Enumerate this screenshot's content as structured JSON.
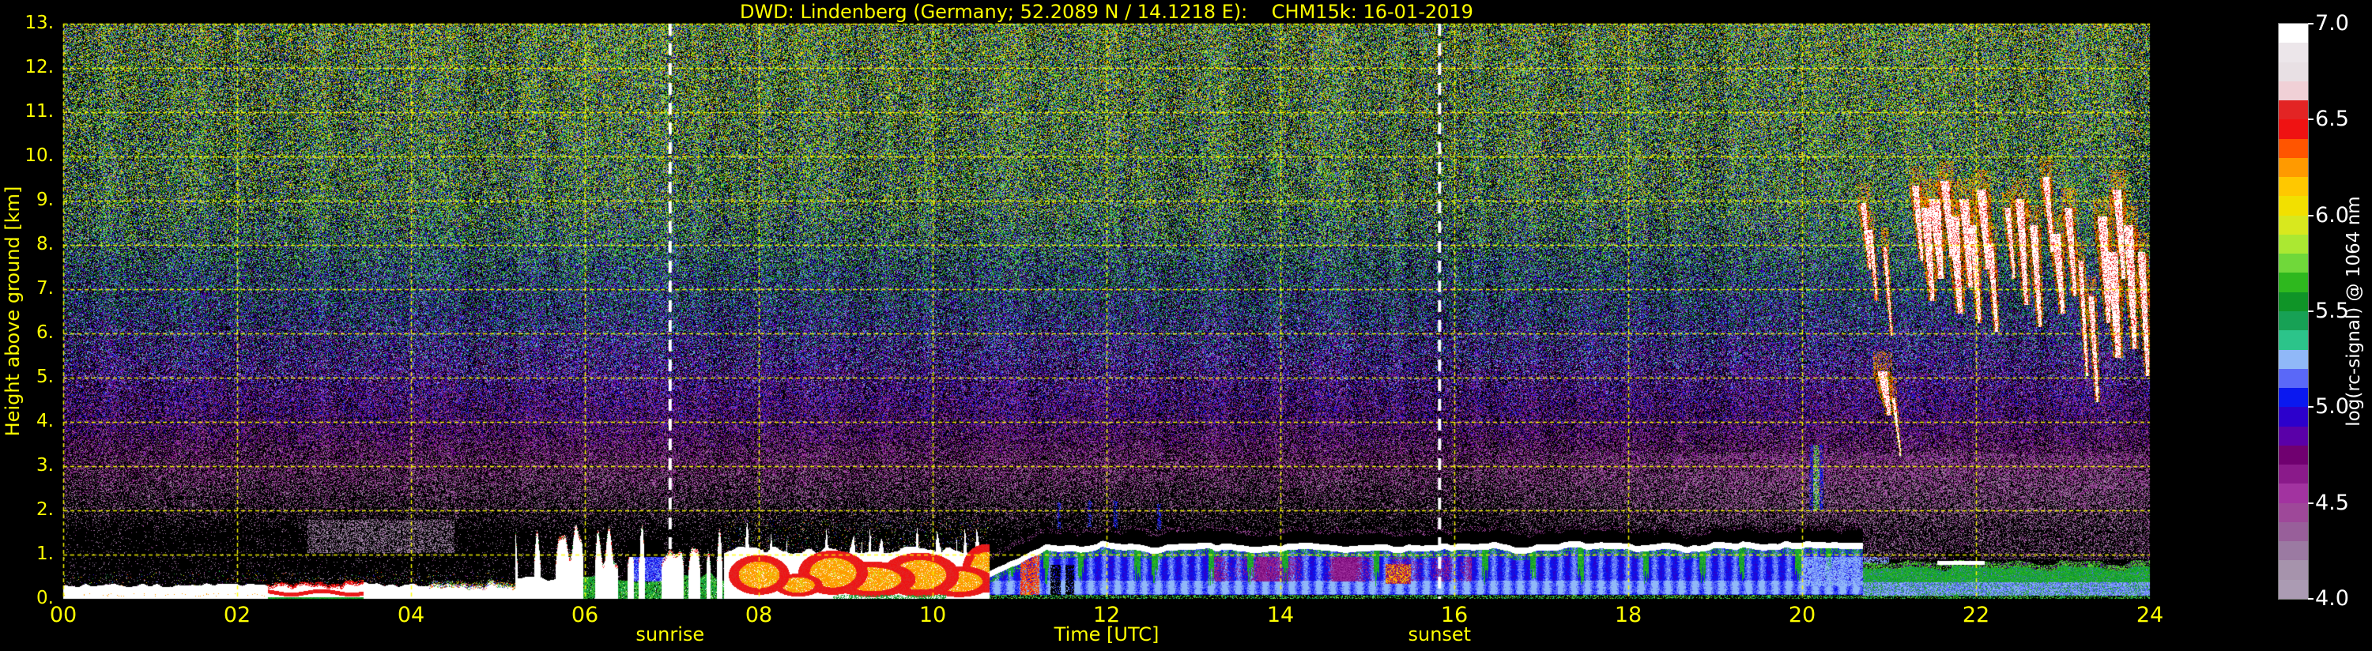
{
  "title": "DWD: Lindenberg (Germany; 52.2089 N / 14.1218 E):    CHM15k: 16-01-2019",
  "colors": {
    "background": "#000000",
    "axis_text": "#ffff00",
    "grid_line": "#ffff00",
    "sun_line": "#ffffff",
    "colorbar_text": "#ffffff",
    "colorbar_border": "#777777"
  },
  "x_axis": {
    "label": "Time [UTC]",
    "tick_labels": [
      "00",
      "02",
      "04",
      "06",
      "08",
      "10",
      "12",
      "14",
      "16",
      "18",
      "20",
      "22",
      "24"
    ],
    "tick_hours": [
      0,
      2,
      4,
      6,
      8,
      10,
      12,
      14,
      16,
      18,
      20,
      22,
      24
    ],
    "range_hours": [
      0,
      24
    ]
  },
  "y_axis": {
    "label": "Height above ground [km]",
    "tick_labels": [
      "0.",
      "1.",
      "2.",
      "3.",
      "4.",
      "5.",
      "6.",
      "7.",
      "8.",
      "9.",
      "10.",
      "11.",
      "12.",
      "13."
    ],
    "tick_km": [
      0,
      1,
      2,
      3,
      4,
      5,
      6,
      7,
      8,
      9,
      10,
      11,
      12,
      13
    ],
    "range_km": [
      0,
      13
    ]
  },
  "annotations": {
    "sunrise": {
      "label": "sunrise",
      "hour": 6.98
    },
    "sunset": {
      "label": "sunset",
      "hour": 15.83
    }
  },
  "colorbar": {
    "label": "log(rc-signal) @ 1064 nm",
    "tick_labels": [
      "7.0",
      "6.5",
      "6.0",
      "5.5",
      "5.0",
      "4.5",
      "4.0"
    ],
    "tick_values": [
      7.0,
      6.5,
      6.0,
      5.5,
      5.0,
      4.5,
      4.0
    ],
    "vmin": 4.0,
    "vmax": 7.0,
    "stops": [
      "#ab9bb3",
      "#a693ac",
      "#9b7aa2",
      "#985f9a",
      "#9e4899",
      "#a233a0",
      "#8a1a8a",
      "#700070",
      "#5a00a8",
      "#2c00cc",
      "#0a18f0",
      "#5a68f8",
      "#90b8f8",
      "#2cc48a",
      "#17a155",
      "#0f9427",
      "#2eb81e",
      "#70d83a",
      "#abe832",
      "#d8e81e",
      "#f2e000",
      "#ffc800",
      "#ff9a00",
      "#ff5500",
      "#ef1212",
      "#e32424",
      "#f0d0d6",
      "#e8e0e4",
      "#ece6ea",
      "#ffffff"
    ]
  },
  "grid": {
    "x_step_hours": 2,
    "y_step_km": 1,
    "style": "dashed"
  },
  "chart_data": {
    "type": "heatmap",
    "title": "DWD: Lindenberg (Germany; 52.2089 N / 14.1218 E):    CHM15k: 16-01-2019",
    "xlabel": "Time [UTC]",
    "ylabel": "Height above ground [km]",
    "value_label": "log(rc-signal) @ 1064 nm",
    "x_range": [
      0,
      24
    ],
    "y_range": [
      0,
      13
    ],
    "value_range": [
      4.0,
      7.0
    ],
    "data_end_hour": 24,
    "description": "Ceilometer range-corrected signal quicklook. Shallow fog/aerosol layer (white, log>6.9) below ~0.4 km from 00-05 UTC with embedded red band 02:20-03:30; lifting plumes 05-07:30 UTC; strong convective red/white cells up to ~1.5 km 07:30-10:40 UTC; stratus deck ~1.0-1.2 km with white cloud top line, attenuation black band above and periwinkle-blue sub-cloud layer 10:40-20:40 UTC with dark maroon mottling 13-16 UTC; evening shallow green aerosol layer below ~0.8 km; cirrus fall-streaks (white cores, orange fringes) 4.5-9.5 km from 20:40-24:00 UTC; height-increasing speckle noise elsewhere.",
    "features": {
      "noise_profile": [
        [
          0,
          0.05,
          4.25,
          0.35
        ],
        [
          1.5,
          0.05,
          4.25,
          0.35
        ],
        [
          2.0,
          0.22,
          4.32,
          0.45
        ],
        [
          2.8,
          0.47,
          4.45,
          0.6
        ],
        [
          4.2,
          0.56,
          4.72,
          0.85
        ],
        [
          6.5,
          0.63,
          5.12,
          1.05
        ],
        [
          9.0,
          0.66,
          5.5,
          1.3
        ],
        [
          13.0,
          0.68,
          5.62,
          1.4
        ]
      ],
      "evening_purple": {
        "t_start": 16,
        "t_full": 19,
        "h_min": 0.9,
        "h_max": 3.3,
        "extra_fill": 0.27,
        "v_center": 4.35,
        "v_spread": 0.5
      },
      "morning_mauve_patch": {
        "t0": 2.8,
        "t1": 4.5,
        "h0": 1.05,
        "h1": 1.8,
        "fill": 0.4,
        "v_center": 4.2,
        "v_spread": 0.3
      },
      "fog_layer": {
        "t0": 0,
        "t1": 5.2,
        "top_km": 0.27,
        "top_wave": 0.09,
        "spike_km": 0.15,
        "red_band": {
          "t0": 2.35,
          "t1": 3.45,
          "h0": 0.08,
          "h1": 0.17
        },
        "green_under": {
          "t0": 2.5,
          "t1": 3.35,
          "h": 0.05
        },
        "red_fringe": {
          "t0": 2.3,
          "t1": 3.35
        }
      },
      "plume_period": {
        "t0": 5.2,
        "t1": 7.6,
        "green_top": 0.5,
        "plume_min": 0.75,
        "plume_max": 1.7,
        "blue_patch": {
          "t0": 6.55,
          "t1": 7.1,
          "h0": 0.4,
          "h1": 0.95
        },
        "black_gap": {
          "t0": 6.5,
          "t1": 6.9,
          "h0": 0.95,
          "h1": 1.35
        }
      },
      "cell_period": {
        "t0": 7.6,
        "t1": 10.65,
        "top_km": 1.0,
        "top_wave": 0.2,
        "spire_km": 0.55,
        "red_cells": [
          [
            8.0,
            0.55,
            0.35,
            0.45
          ],
          [
            8.45,
            0.32,
            0.28,
            0.26
          ],
          [
            8.85,
            0.6,
            0.4,
            0.5
          ],
          [
            9.3,
            0.45,
            0.5,
            0.4
          ],
          [
            9.85,
            0.55,
            0.45,
            0.5
          ],
          [
            10.3,
            0.4,
            0.4,
            0.35
          ],
          [
            10.62,
            0.7,
            0.28,
            0.55
          ]
        ],
        "green_bottom": {
          "t0": 8.85,
          "t1": 10.15,
          "h": 0.1
        }
      },
      "stratus": {
        "t0": 10.65,
        "t1": 20.7,
        "cap_km": 1.08,
        "black_band_km": 0.38,
        "light_band": [
          0.12,
          0.42
        ],
        "maroon": {
          "t0": 13.2,
          "t1": 16.2,
          "h0": 0.4,
          "h1": 0.95
        },
        "red_patch": {
          "t0": 15.2,
          "t1": 15.5,
          "h0": 0.35,
          "h1": 0.8
        },
        "red_streaks": {
          "t0": 11.0,
          "t1": 11.22
        },
        "green_streak_times": [
          10.9,
          11.3,
          11.7,
          12.35,
          12.55,
          13.2,
          13.65,
          14.05,
          15.1,
          16.35,
          16.9,
          17.45,
          18.2,
          18.85,
          19.3,
          19.95,
          20.3
        ],
        "black_gaps": [
          [
            11.35,
            11.47
          ],
          [
            11.52,
            11.62
          ]
        ],
        "drizzle_times": [
          11.45,
          11.8,
          12.1,
          12.6
        ],
        "pale_haze_t0": 20.0
      },
      "evening_layer": {
        "t0": 20.7,
        "t1": 24,
        "green_top": 0.62,
        "green_wave": 0.15,
        "pale_haze": {
          "t0": 20.1,
          "t1": 21.0,
          "h0": 0.3,
          "h1": 0.95
        },
        "white_line": {
          "t0": 21.55,
          "t1": 22.1,
          "h": 0.82
        },
        "black_specks": {
          "t0": 21.65,
          "t1": 22.05,
          "h0": 0.88,
          "h1": 1.05
        },
        "light_band": [
          0.1,
          0.38
        ]
      },
      "cyan_streak": {
        "t0": 20.08,
        "t1": 20.24,
        "h0": 2.0,
        "h1": 3.5
      },
      "cirrus": {
        "t0": 20.6,
        "t1": 24,
        "streaks": [
          [
            20.7,
            8.9,
            7.6,
            0.06
          ],
          [
            20.78,
            8.3,
            6.9,
            0.05
          ],
          [
            20.95,
            7.9,
            6.1,
            0.04
          ],
          [
            20.92,
            5.1,
            4.3,
            0.1
          ],
          [
            21.05,
            4.5,
            3.4,
            0.035
          ],
          [
            21.3,
            9.3,
            7.8,
            0.07
          ],
          [
            21.42,
            8.8,
            6.9,
            0.1
          ],
          [
            21.52,
            9.0,
            7.4,
            0.12
          ],
          [
            21.64,
            9.4,
            7.9,
            0.09
          ],
          [
            21.74,
            8.6,
            6.6,
            0.11
          ],
          [
            21.86,
            9.0,
            7.2,
            0.1
          ],
          [
            21.96,
            8.4,
            6.4,
            0.08
          ],
          [
            22.06,
            9.2,
            7.6,
            0.1
          ],
          [
            22.16,
            8.0,
            6.2,
            0.07
          ],
          [
            22.36,
            8.8,
            7.4,
            0.06
          ],
          [
            22.5,
            9.0,
            6.8,
            0.09
          ],
          [
            22.66,
            8.4,
            6.3,
            0.08
          ],
          [
            22.8,
            9.5,
            8.0,
            0.07
          ],
          [
            22.92,
            8.2,
            6.6,
            0.09
          ],
          [
            23.06,
            8.8,
            7.0,
            0.08
          ],
          [
            23.2,
            7.6,
            5.2,
            0.05
          ],
          [
            23.32,
            6.8,
            4.6,
            0.06
          ],
          [
            23.45,
            8.6,
            6.4,
            0.1
          ],
          [
            23.56,
            7.8,
            5.6,
            0.12
          ],
          [
            23.62,
            9.2,
            7.4,
            0.09
          ],
          [
            23.75,
            8.4,
            5.8,
            0.1
          ],
          [
            23.9,
            7.8,
            5.2,
            0.08
          ]
        ]
      }
    }
  }
}
